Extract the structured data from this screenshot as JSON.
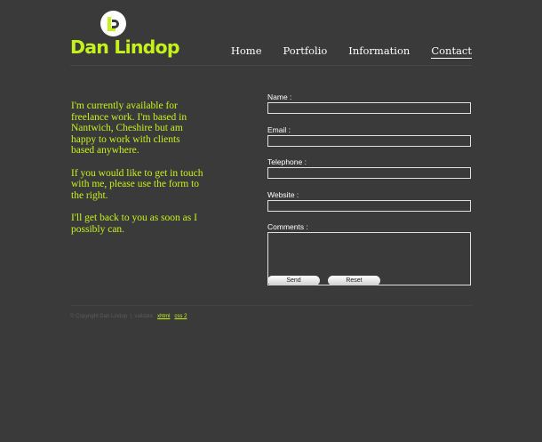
{
  "brand": {
    "name": "Dan Lindop",
    "accent": "#c6f21c",
    "background": "#3a3a3a"
  },
  "nav": {
    "items": [
      {
        "label": "Home",
        "active": false
      },
      {
        "label": "Portfolio",
        "active": false
      },
      {
        "label": "Information",
        "active": false
      },
      {
        "label": "Contact",
        "active": true
      }
    ]
  },
  "intro": {
    "paragraphs": [
      "I'm currently available for freelance work. I'm based in Nantwich, Cheshire but am happy to work with clients based anywhere.",
      "If you would like to get in touch with me, please use the form to the right.",
      "I'll get back to you as soon as I possibly can."
    ]
  },
  "form": {
    "name_label": "Name :",
    "email_label": "Email :",
    "telephone_label": "Telephone :",
    "website_label": "Website :",
    "comments_label": "Comments :",
    "name_value": "",
    "email_value": "",
    "telephone_value": "",
    "website_value": "",
    "comments_value": "",
    "send_label": "Send",
    "reset_label": "Reset"
  },
  "footer": {
    "copyright": "© Copyright Dan Lindop",
    "separator": "|",
    "validate": "validate :",
    "xhtml": "xhtml",
    "divider": ":",
    "css": "css 2"
  }
}
